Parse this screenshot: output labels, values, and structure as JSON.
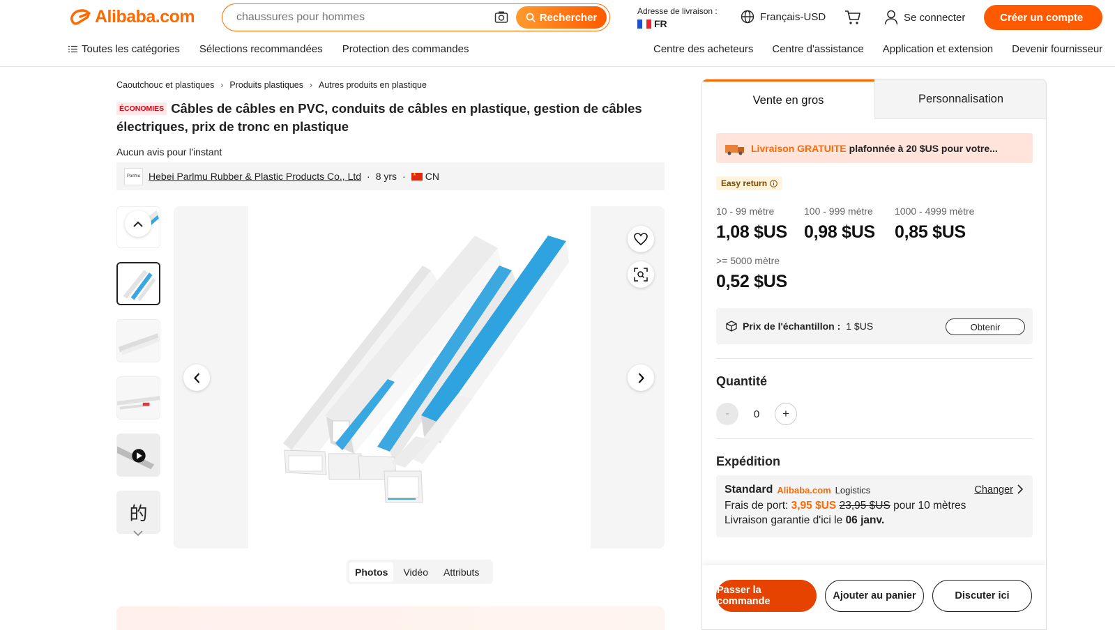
{
  "header": {
    "logo_text": "Alibaba.com",
    "search_placeholder": "chaussures pour hommes",
    "search_button": "Rechercher",
    "ship_label": "Adresse de livraison :",
    "ship_country": "FR",
    "language": "Français-USD",
    "signin": "Se connecter",
    "create_account": "Créer un compte",
    "nav_left": [
      "Toutes les catégories",
      "Sélections recommandées",
      "Protection des commandes"
    ],
    "nav_right": [
      "Centre des acheteurs",
      "Centre d'assistance",
      "Application et extension",
      "Devenir fournisseur"
    ]
  },
  "breadcrumb": [
    "Caoutchouc et plastiques",
    "Produits plastiques",
    "Autres produits en plastique"
  ],
  "product": {
    "badge": "ÉCONOMIES",
    "title": "Câbles de câbles en PVC, conduits de câbles en plastique, gestion de câbles électriques, prix de tronc en plastique",
    "reviews": "Aucun avis pour l'instant",
    "supplier_logo": "Parlmu",
    "supplier_name": "Hebei Parlmu Rubber & Plastic Products Co., Ltd",
    "supplier_years": "8 yrs",
    "supplier_country": "CN",
    "media_tabs": [
      "Photos",
      "Vidéo",
      "Attributs"
    ],
    "thumbnail_last_glyph": "的"
  },
  "panel": {
    "tab_wholesale": "Vente en gros",
    "tab_custom": "Personnalisation",
    "free_shipping_highlight": "Livraison GRATUITE",
    "free_shipping_rest": "plafonnée à 20 $US pour votre...",
    "easy_return": "Easy return",
    "tiers": [
      {
        "range": "10 - 99 mètre",
        "price": "1,08 $US"
      },
      {
        "range": "100 - 999 mètre",
        "price": "0,98 $US"
      },
      {
        "range": "1000 - 4999 mètre",
        "price": "0,85 $US"
      },
      {
        "range": ">= 5000 mètre",
        "price": "0,52 $US"
      }
    ],
    "sample_label": "Prix de l'échantillon :",
    "sample_price": "1 $US",
    "sample_button": "Obtenir",
    "quantity_title": "Quantité",
    "quantity_minus": "-",
    "quantity_value": "0",
    "quantity_plus": "+",
    "shipping_title": "Expédition",
    "shipping_method": "Standard",
    "shipping_brand": "Alibaba.com",
    "shipping_logistics": "Logistics",
    "shipping_change": "Changer",
    "shipping_fee_label": "Frais de port:",
    "shipping_fee": "3,95 $US",
    "shipping_fee_old": "23,95 $US",
    "shipping_fee_unit": "pour 10 mètres",
    "delivery_label": "Livraison garantie d'ici le",
    "delivery_date": "06 janv.",
    "btn_order": "Passer la commande",
    "btn_cart": "Ajouter au panier",
    "btn_chat": "Discuter ici"
  },
  "colors": {
    "accent": "#ff6a00",
    "primary_button": "#e64300",
    "badge_red": "#d4061a"
  }
}
